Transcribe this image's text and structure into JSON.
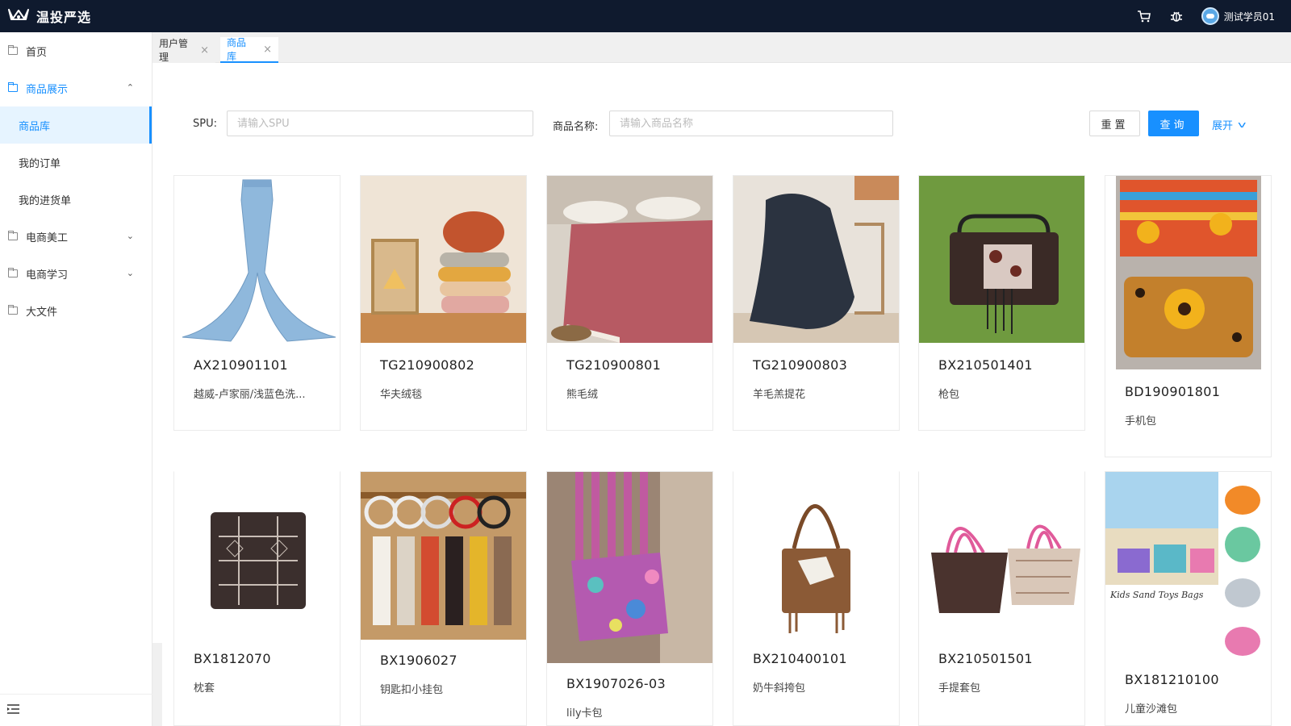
{
  "app": {
    "title": "温投严选",
    "username": "测试学员01"
  },
  "sidebar": {
    "items": [
      {
        "label": "首页"
      },
      {
        "label": "商品展示"
      },
      {
        "label": "商品库"
      },
      {
        "label": "我的订单"
      },
      {
        "label": "我的进货单"
      },
      {
        "label": "电商美工"
      },
      {
        "label": "电商学习"
      },
      {
        "label": "大文件"
      }
    ]
  },
  "tabs": [
    {
      "label": "用户管理"
    },
    {
      "label": "商品库"
    }
  ],
  "search": {
    "spu_label": "SPU:",
    "spu_placeholder": "请输入SPU",
    "spu_value": "",
    "name_label": "商品名称:",
    "name_placeholder": "请输入商品名称",
    "name_value": "",
    "reset_label": "重置",
    "query_label": "查询",
    "expand_label": "展开"
  },
  "products": [
    {
      "spu": "AX210901101",
      "name": "越威-卢家丽/浅蓝色洗..."
    },
    {
      "spu": "TG210900802",
      "name": "华夫绒毯"
    },
    {
      "spu": "TG210900801",
      "name": "熊毛绒"
    },
    {
      "spu": "TG210900803",
      "name": "羊毛羔提花"
    },
    {
      "spu": "BX210501401",
      "name": "枪包"
    },
    {
      "spu": "BD190901801",
      "name": "手机包"
    },
    {
      "spu": "BX1812070",
      "name": "枕套"
    },
    {
      "spu": "BX1906027",
      "name": "钥匙扣小挂包"
    },
    {
      "spu": "BX1907026-03",
      "name": "lily卡包"
    },
    {
      "spu": "BX210400101",
      "name": "奶牛斜挎包"
    },
    {
      "spu": "BX210501501",
      "name": "手提套包"
    },
    {
      "spu": "BX181210100",
      "name": "儿童沙滩包"
    }
  ],
  "product_images": [
    {
      "text": ""
    },
    {
      "text": ""
    },
    {
      "text": ""
    },
    {
      "text": ""
    },
    {
      "text": ""
    },
    {
      "text": ""
    },
    {
      "text": ""
    },
    {
      "text": ""
    },
    {
      "text": ""
    },
    {
      "text": ""
    },
    {
      "text": ""
    },
    {
      "text": "Kids Sand Toys Bags"
    }
  ],
  "colors": {
    "topbar": "#0f1a2e",
    "accent": "#1890ff"
  }
}
